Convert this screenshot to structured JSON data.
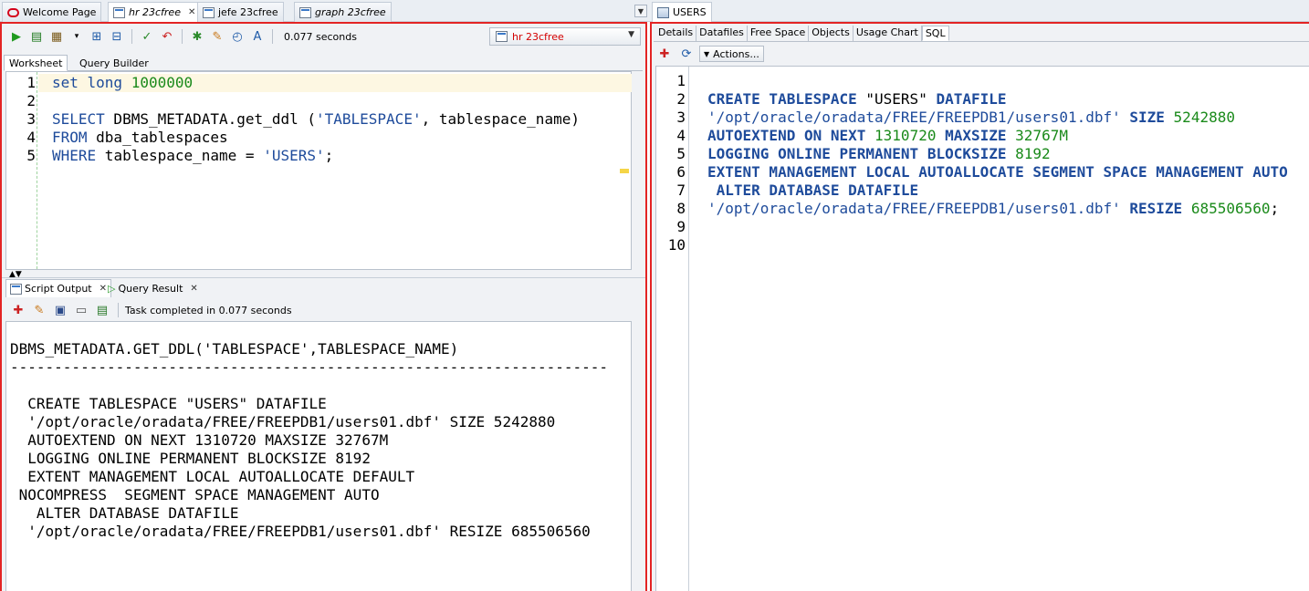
{
  "doc_tabs": [
    {
      "label": "Welcome Page",
      "icon": "oracle-icon",
      "italic": false
    },
    {
      "label": "hr 23cfree",
      "icon": "sql-icon",
      "italic": true
    },
    {
      "label": "jefe 23cfree",
      "icon": "sql-icon",
      "italic": false
    },
    {
      "label": "graph 23cfree",
      "icon": "sql-icon",
      "italic": true
    }
  ],
  "right_doc_tab": {
    "label": "USERS"
  },
  "toolbar": {
    "elapsed": "0.077 seconds",
    "connection": "hr 23cfree"
  },
  "subtabs": [
    "Worksheet",
    "Query Builder"
  ],
  "editor": {
    "line_numbers": [
      "1",
      "2",
      "3",
      "4",
      "5"
    ],
    "l1a": "set long ",
    "l1b": "1000000",
    "l3a": "SELECT",
    "l3b": " DBMS_METADATA.get_ddl (",
    "l3c": "'TABLESPACE'",
    "l3d": ", tablespace_name)",
    "l4a": "FROM",
    "l4b": " dba_tablespaces",
    "l5a": "WHERE",
    "l5b": " tablespace_name = ",
    "l5c": "'USERS'",
    "l5d": ";"
  },
  "output_tabs": [
    "Script Output",
    "Query Result"
  ],
  "output_status": "Task completed in 0.077 seconds",
  "output_lines": [
    "DBMS_METADATA.GET_DDL('TABLESPACE',TABLESPACE_NAME)",
    "--------------------------------------------------------------------",
    "",
    "  CREATE TABLESPACE \"USERS\" DATAFILE",
    "  '/opt/oracle/oradata/FREE/FREEPDB1/users01.dbf' SIZE 5242880",
    "  AUTOEXTEND ON NEXT 1310720 MAXSIZE 32767M",
    "  LOGGING ONLINE PERMANENT BLOCKSIZE 8192",
    "  EXTENT MANAGEMENT LOCAL AUTOALLOCATE DEFAULT",
    " NOCOMPRESS  SEGMENT SPACE MANAGEMENT AUTO",
    "   ALTER DATABASE DATAFILE",
    "  '/opt/oracle/oradata/FREE/FREEPDB1/users01.dbf' RESIZE 685506560"
  ],
  "right_tabs": [
    "Details",
    "Datafiles",
    "Free Space",
    "Objects",
    "Usage Chart",
    "SQL"
  ],
  "actions_label": "Actions...",
  "right_editor": {
    "line_numbers": [
      "1",
      "2",
      "3",
      "4",
      "5",
      "6",
      "7",
      "8",
      "9",
      "10"
    ],
    "r2a": "CREATE TABLESPACE ",
    "r2b": "\"USERS\"",
    "r2c": " DATAFILE",
    "r3a": "'/opt/oracle/oradata/FREE/FREEPDB1/users01.dbf'",
    "r3b": " SIZE ",
    "r3c": "5242880",
    "r4a": "AUTOEXTEND ON NEXT ",
    "r4b": "1310720",
    "r4c": " MAXSIZE ",
    "r4d": "32767M",
    "r5a": "LOGGING ONLINE PERMANENT BLOCKSIZE ",
    "r5b": "8192",
    "r6a": "EXTENT MANAGEMENT LOCAL AUTOALLOCATE SEGMENT SPACE MANAGEMENT AUTO",
    "r7a": " ALTER DATABASE DATAFILE",
    "r8a": "'/opt/oracle/oradata/FREE/FREEPDB1/users01.dbf'",
    "r8b": " RESIZE ",
    "r8c": "685506560",
    "r8d": ";"
  }
}
